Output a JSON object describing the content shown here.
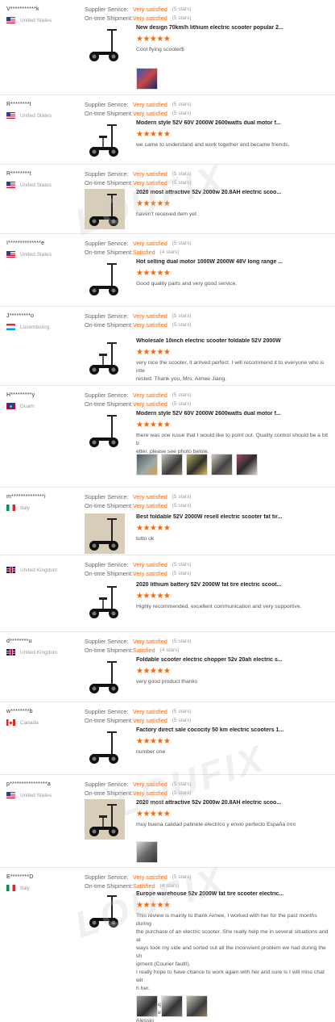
{
  "labels": {
    "supplier_service": "Supplier Service:",
    "shipment": "On-time Shipment:"
  },
  "watermark": "LOUFIX",
  "colors": {
    "accent": "#ff6600",
    "muted": "#999999"
  },
  "reviews": [
    {
      "buyer": "V***********k",
      "country": "United States",
      "flag": "us",
      "supplier_service": "Very satisfied",
      "supplier_stars": "(5 stars)",
      "shipment": "Very satisfied",
      "shipment_stars": "(5 stars)",
      "product_title": "New design 70km/h lithium electric scooter popular 2...",
      "stars": "★★★★★",
      "text": "Cool flying scooter$",
      "photos": [
        "ph-f"
      ]
    },
    {
      "buyer": "R********t",
      "country": "United States",
      "flag": "us",
      "supplier_service": "Very satisfied",
      "supplier_stars": "(5 stars)",
      "shipment": "Very satisfied",
      "shipment_stars": "(5 stars)",
      "product_title": "Modern style 52V 60V 2000W 2600watts dual motor f...",
      "stars": "★★★★★",
      "text": "we came to understand and work together and became friends.",
      "photos": []
    },
    {
      "buyer": "R********t",
      "country": "United States",
      "flag": "us",
      "supplier_service": "Very satisfied",
      "supplier_stars": "(5 stars)",
      "shipment": "Very satisfied",
      "shipment_stars": "(5 stars)",
      "product_title": "2020 most attractive 52v 2000w 20.8AH electric scoo...",
      "stars": "★★★★★",
      "text": "haven't received item yet .",
      "photos": []
    },
    {
      "buyer": "I**************e",
      "country": "United States",
      "flag": "us",
      "supplier_service": "Very satisfied",
      "supplier_stars": "(5 stars)",
      "shipment": "Satisfied",
      "shipment_stars": "(4 stars)",
      "product_title": "Hot selling dual motor 1000W 2000W 48V long range ...",
      "stars": "★★★★★",
      "text": "Good quality parts and very good service.",
      "photos": []
    },
    {
      "buyer": "J*********o",
      "country": "Luxembourg",
      "flag": "lu",
      "supplier_service": "Very satisfied",
      "supplier_stars": "(5 stars)",
      "shipment": "Very satisfied",
      "shipment_stars": "(5 stars)",
      "product_title": "Wholesale 10inch electric scooter foldable 52V 2000W",
      "stars": "★★★★★",
      "text": "very nice the scooter, it arrived perfect. I will recommend it to everyone who is inte\nrested. Thank you, Mrs. Aimee Jiang.",
      "photos": []
    },
    {
      "buyer": "H*********y",
      "country": "Guam",
      "flag": "gu",
      "supplier_service": "Very satisfied",
      "supplier_stars": "(5 stars)",
      "shipment": "Very satisfied",
      "shipment_stars": "(5 stars)",
      "product_title": "Modern style 52V 60V 2000W 2600watts dual motor f...",
      "stars": "★★★★★",
      "text": "there was one issue that I would like to point out. Quality control should be a bit b\netter. please see photo below.",
      "photos": [
        "ph-a",
        "ph-b",
        "ph-c",
        "ph-d",
        "ph-e"
      ]
    },
    {
      "buyer": "m**************i",
      "country": "Italy",
      "flag": "it",
      "supplier_service": "Very satisfied",
      "supplier_stars": "(5 stars)",
      "shipment": "Very satisfied",
      "shipment_stars": "(5 stars)",
      "product_title": "Best foldable 52V 2000W resell electric scooter fat tir...",
      "stars": "★★★★★",
      "text": "tutto ok",
      "photos": []
    },
    {
      "buyer": "",
      "country": "United Kingdom",
      "flag": "uk",
      "supplier_service": "Very satisfied",
      "supplier_stars": "(5 stars)",
      "shipment": "Very satisfied",
      "shipment_stars": "(5 stars)",
      "product_title": "2020 lithium battery 52V 2000W fat tire electric scoot...",
      "stars": "★★★★★",
      "text": "Highly recommended, excellent communication and very supportive.",
      "photos": []
    },
    {
      "buyer": "d********u",
      "country": "United Kingdom",
      "flag": "uk",
      "supplier_service": "Very satisfied",
      "supplier_stars": "(5 stars)",
      "shipment": "Satisfied",
      "shipment_stars": "(4 stars)",
      "product_title": "Foldable scooter electric chopper 52v 20ah electric s...",
      "stars": "★★★★★",
      "text": "very good product thanks",
      "photos": []
    },
    {
      "buyer": "w********b",
      "country": "Canada",
      "flag": "ca",
      "supplier_service": "Very satisfied",
      "supplier_stars": "(5 stars)",
      "shipment": "Very satisfied",
      "shipment_stars": "(5 stars)",
      "product_title": "Factory direct sale cococity 50 km electric scooters 1...",
      "stars": "★★★★★",
      "text": "number one",
      "photos": []
    },
    {
      "buyer": "p****************a",
      "country": "United States",
      "flag": "us",
      "supplier_service": "Very satisfied",
      "supplier_stars": "(5 stars)",
      "shipment": "Very satisfied",
      "shipment_stars": "(5 stars)",
      "product_title": "2020 most attractive 52v 2000w 20.8AH electric scoo...",
      "stars": "★★★★★",
      "text": "muy buena calidad patinete electrico y envio perfecto España ¤¤¤",
      "photos": [
        "ph-g"
      ]
    },
    {
      "buyer": "E********D",
      "country": "Italy",
      "flag": "it",
      "supplier_service": "Very satisfied",
      "supplier_stars": "(5 stars)",
      "shipment": "Satisfied",
      "shipment_stars": "(4 stars)",
      "product_title": "Europe warehouse 52v 2000W fat tire scooter electric...",
      "stars": "★★★★★",
      "text": "This review is mainly to thank Aimee, I worked with her for the past months during\nthe purchase of an electric scooter. She really help me in several situations and al\nways took my side and sorted out all the inconvient problem we had during the sh\nipment (Courier fault!).\nI really hope to have chance to work again with her and sure is I will miss chat wit\nh her.\n\nThanks again.\nBest regards,\nAlessio",
      "photos": [
        "ph-h",
        "ph-i",
        "ph-b"
      ]
    }
  ]
}
